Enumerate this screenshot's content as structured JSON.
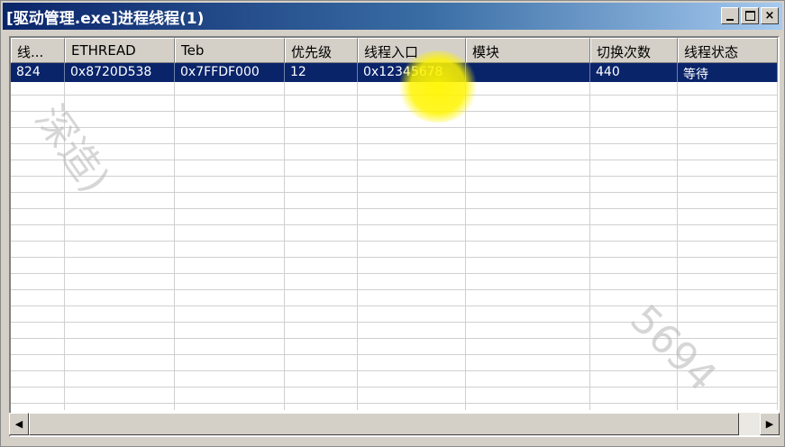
{
  "window": {
    "title": "[驱动管理.exe]进程线程(1)",
    "buttons": {
      "minimize": "_",
      "maximize": "□",
      "close": "×"
    }
  },
  "table": {
    "columns": [
      "线...",
      "ETHREAD",
      "Teb",
      "优先级",
      "线程入口",
      "模块",
      "切换次数",
      "线程状态"
    ],
    "rows": [
      [
        "824",
        "0x8720D538",
        "0x7FFDF000",
        "12",
        "0x12345678",
        "",
        "440",
        "等待"
      ]
    ]
  },
  "watermarks": [
    "深造)",
    "5694"
  ],
  "scrollbar": {
    "left_arrow": "◀",
    "right_arrow": "▶"
  },
  "colors": {
    "selection": "#0a246a",
    "highlight": "#fff500"
  }
}
